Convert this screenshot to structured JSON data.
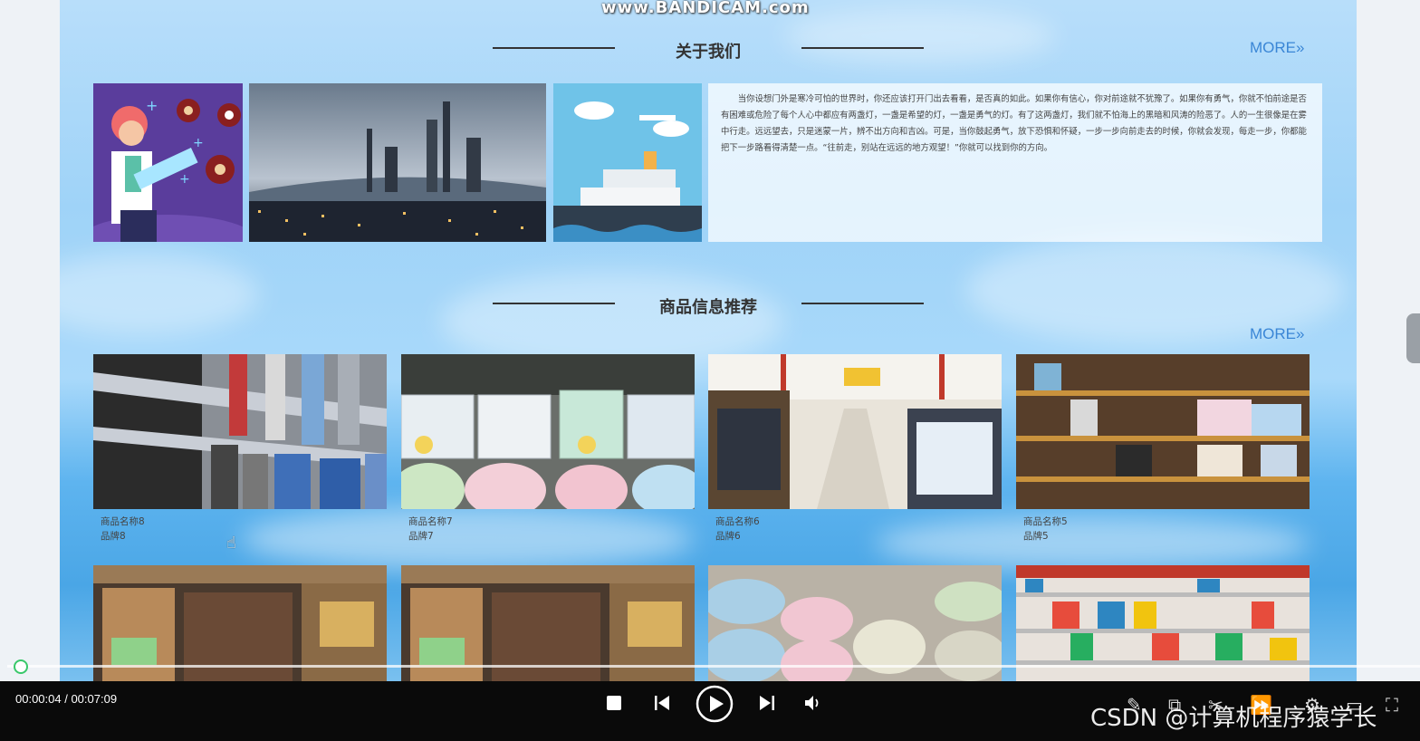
{
  "watermark": "www.BANDICAM.com",
  "about": {
    "title": "关于我们",
    "more_label": "MORE»",
    "text": "当你设想门外是寒冷可怕的世界时，你还应该打开门出去看看，是否真的如此。如果你有信心，你对前途就不犹豫了。如果你有勇气，你就不怕前途是否有困难或危险了每个人心中都应有两盏灯，一盏是希望的灯，一盏是勇气的灯。有了这两盏灯，我们就不怕海上的黑暗和风涛的险恶了。人的一生很像是在雾中行走。远远望去，只是迷蒙一片，辨不出方向和吉凶。可是，当你鼓起勇气，放下恐惧和怀疑，一步一步向前走去的时候，你就会发现，每走一步，你都能把下一步路看得清楚一点。“往前走，别站在远远的地方观望！”你就可以找到你的方向。"
  },
  "products": {
    "title": "商品信息推荐",
    "more_label": "MORE»",
    "items": [
      {
        "name": "商品名称8",
        "brand": "品牌8"
      },
      {
        "name": "商品名称7",
        "brand": "品牌7"
      },
      {
        "name": "商品名称6",
        "brand": "品牌6"
      },
      {
        "name": "商品名称5",
        "brand": "品牌5"
      }
    ]
  },
  "player": {
    "time": "00:00:04 / 00:07:09",
    "progress": 0.0093,
    "csdn_watermark": "CSDN @计算机程序猿学长"
  },
  "icons": [
    "stop-icon",
    "prev-icon",
    "play-icon",
    "next-icon",
    "volume-icon",
    "edit-icon",
    "crop-icon",
    "scissors-icon",
    "speed-icon",
    "settings-icon",
    "window-icon",
    "fullscreen-icon"
  ]
}
